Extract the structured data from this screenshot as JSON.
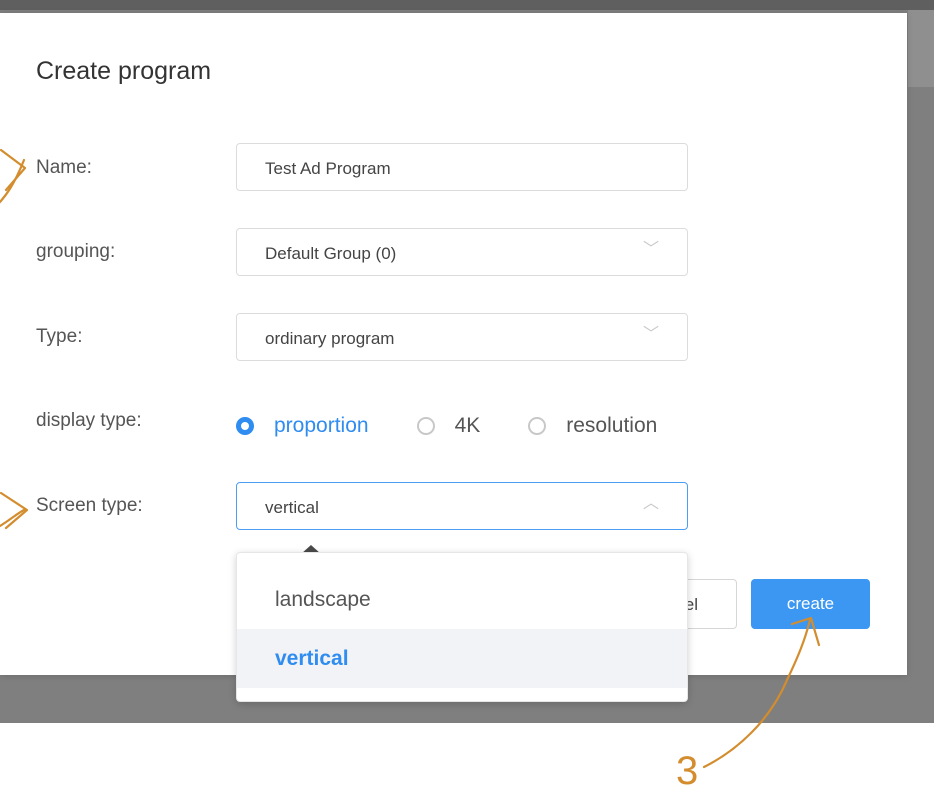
{
  "dialog": {
    "title": "Create program"
  },
  "form": {
    "name": {
      "label": "Name:",
      "value": "Test Ad Program"
    },
    "grouping": {
      "label": "grouping:",
      "value": "Default Group (0)"
    },
    "type": {
      "label": "Type:",
      "value": "ordinary program"
    },
    "display_type": {
      "label": "display type:",
      "options": [
        {
          "label": "proportion",
          "selected": true
        },
        {
          "label": "4K",
          "selected": false
        },
        {
          "label": "resolution",
          "selected": false
        }
      ]
    },
    "screen_type": {
      "label": "Screen type:",
      "value": "vertical",
      "options": [
        {
          "label": "landscape",
          "selected": false
        },
        {
          "label": "vertical",
          "selected": true
        }
      ]
    }
  },
  "buttons": {
    "cancel_visible_text": "el",
    "create": "create"
  },
  "annotation": {
    "number": "3"
  },
  "colors": {
    "accent": "#2f8cf0",
    "annotation": "#d38d2e",
    "backdrop": "#7f7f7f"
  },
  "icons": {
    "chevron_down": "chevron-down-icon",
    "chevron_up": "chevron-up-icon",
    "radio_checked": "radio-checked-icon",
    "radio_unchecked": "radio-unchecked-icon"
  }
}
